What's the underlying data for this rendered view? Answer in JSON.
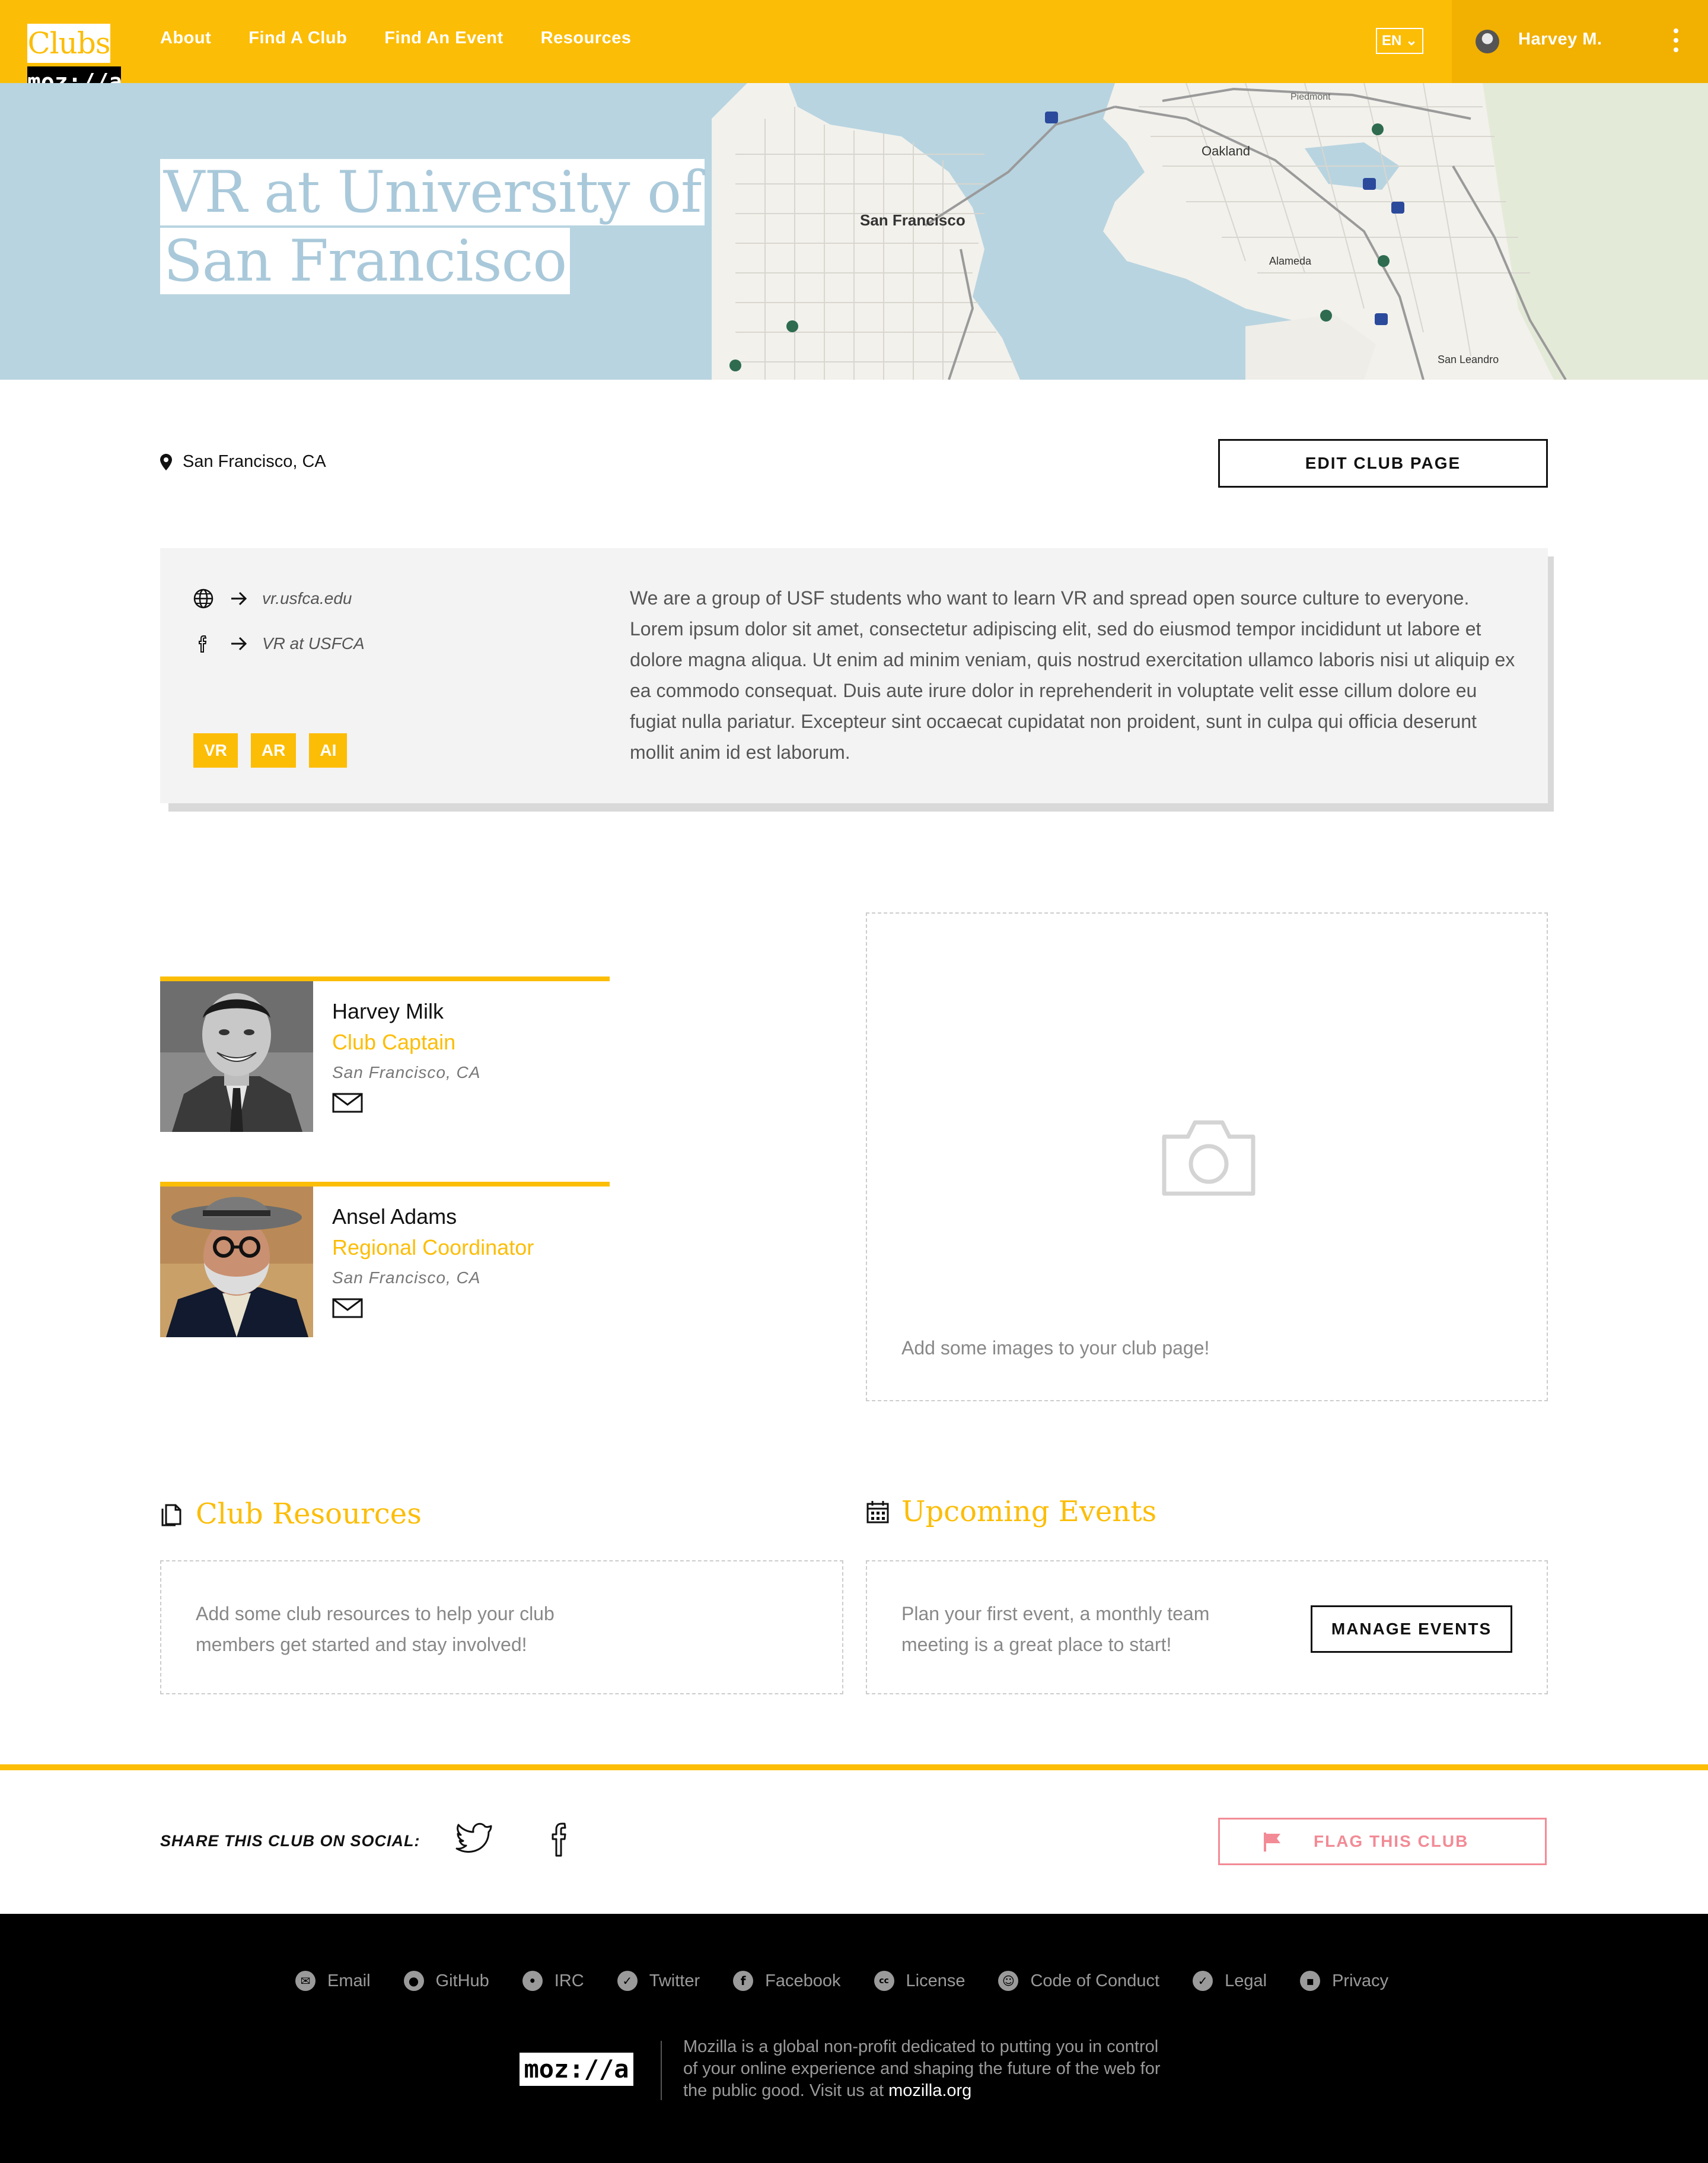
{
  "brand": {
    "app": "Clubs",
    "org": "moz://a"
  },
  "nav": {
    "links": [
      "About",
      "Find A Club",
      "Find An Event",
      "Resources"
    ],
    "language": "EN ⌄",
    "user_name": "Harvey M."
  },
  "hero": {
    "title_line1": "VR at University of",
    "title_line2": "San Francisco",
    "map_labels": [
      "San Francisco",
      "Oakland",
      "Alameda",
      "Piedmont",
      "San Leandro"
    ]
  },
  "club": {
    "location": "San Francisco, CA",
    "edit_label": "EDIT CLUB PAGE",
    "website": "vr.usfca.edu",
    "facebook": "VR at USFCA",
    "tags": [
      "VR",
      "AR",
      "AI"
    ],
    "description": "We are a group of USF students who want to learn VR and spread open source culture to everyone. Lorem ipsum dolor sit amet, consectetur adipiscing elit, sed do eiusmod tempor incididunt ut labore et dolore magna aliqua. Ut enim ad minim veniam, quis nostrud exercitation ullamco laboris nisi ut aliquip ex ea commodo consequat. Duis aute irure dolor in reprehenderit in voluptate velit esse cillum dolore eu fugiat nulla pariatur. Excepteur sint occaecat cupidatat non proident, sunt in culpa qui officia deserunt mollit anim id est laborum."
  },
  "team": [
    {
      "name": "Harvey Milk",
      "role": "Club Captain",
      "location": "San Francisco, CA"
    },
    {
      "name": "Ansel Adams",
      "role": "Regional Coordinator",
      "location": "San Francisco, CA"
    }
  ],
  "gallery": {
    "empty_text": "Add some images to your club page!"
  },
  "resources": {
    "title": "Club Resources",
    "empty_text": "Add some club resources to help your club members get started and stay involved!"
  },
  "events": {
    "title": "Upcoming Events",
    "empty_text": "Plan your first event, a monthly team meeting is a great place to start!",
    "manage_label": "MANAGE EVENTS"
  },
  "share": {
    "label": "SHARE THIS CLUB ON SOCIAL:",
    "flag_label": "FLAG THIS CLUB"
  },
  "footer": {
    "links": [
      "Email",
      "GitHub",
      "IRC",
      "Twitter",
      "Facebook",
      "License",
      "Code of Conduct",
      "Legal",
      "Privacy"
    ],
    "logo": "moz://a",
    "about_line1": "Mozilla is a global non-profit dedicated to putting you in control",
    "about_line2": "of your online experience and shaping the future of the web for",
    "about_line3": "the public good. Visit us at",
    "about_link": "mozilla.org"
  },
  "colors": {
    "accent": "#fcbd06",
    "flag": "#f28b96",
    "footer_bg": "#000000",
    "muted": "#888888"
  }
}
